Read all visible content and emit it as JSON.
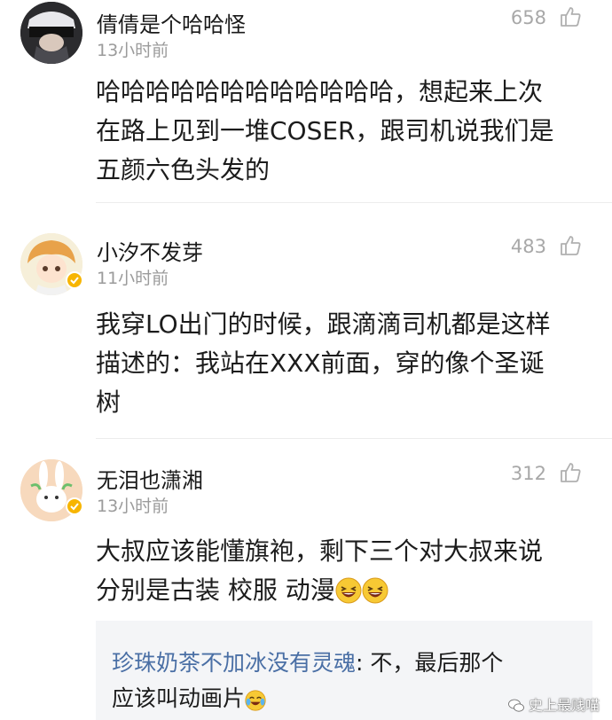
{
  "comments": [
    {
      "username": "倩倩是个哈哈怪",
      "time": "13小时前",
      "likes": "658",
      "lines": [
        "哈哈哈哈哈哈哈哈哈哈哈哈，想起来上次",
        "在路上见到一堆COSER，跟司机说我们是",
        "五颜六色头发的"
      ]
    },
    {
      "username": "小汐不发芽",
      "time": "11小时前",
      "likes": "483",
      "lines": [
        "我穿LO出门的时候，跟滴滴司机都是这样",
        "描述的：我站在XXX前面，穿的像个圣诞",
        "树"
      ]
    },
    {
      "username": "无泪也潇湘",
      "time": "13小时前",
      "likes": "312",
      "lines": [
        "大叔应该能懂旗袍，剩下三个对大叔来说",
        "分别是古装  校服  动漫"
      ]
    }
  ],
  "reply": {
    "username": "珍珠奶茶不加冰没有灵魂",
    "text_line1": "不，最后那个",
    "text_line2": "应该叫动画片"
  },
  "watermark": "史上最贱喵"
}
